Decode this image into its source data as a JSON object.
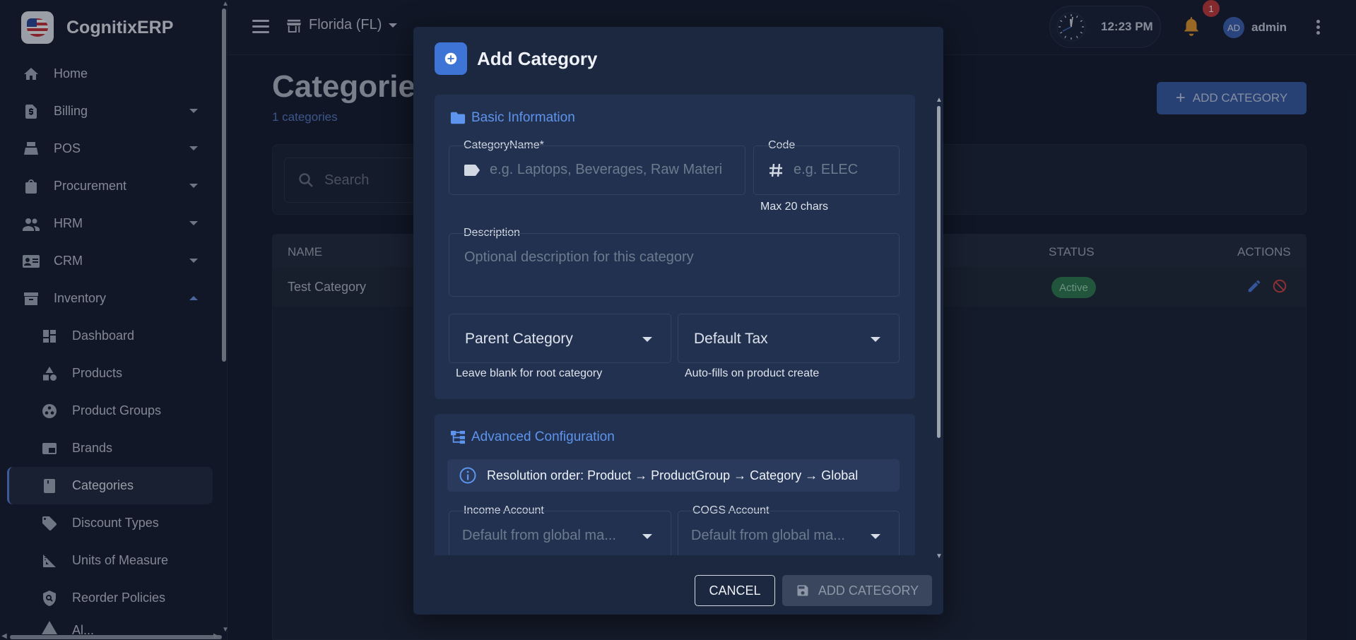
{
  "app": {
    "name": "CognitixERP"
  },
  "topbar": {
    "store": "Florida (FL)",
    "time": "12:23 PM",
    "notifications": "1",
    "avatar_initials": "AD",
    "username": "admin"
  },
  "sidebar": {
    "items": [
      {
        "label": "Home",
        "icon": "home-icon"
      },
      {
        "label": "Billing",
        "icon": "billing-icon"
      },
      {
        "label": "POS",
        "icon": "pos-icon"
      },
      {
        "label": "Procurement",
        "icon": "procurement-icon"
      },
      {
        "label": "HRM",
        "icon": "people-icon"
      },
      {
        "label": "CRM",
        "icon": "contact-card-icon"
      },
      {
        "label": "Inventory",
        "icon": "inventory-icon"
      }
    ],
    "inventory_sub": [
      {
        "label": "Dashboard",
        "icon": "dashboard-icon"
      },
      {
        "label": "Products",
        "icon": "category-shapes-icon"
      },
      {
        "label": "Product Groups",
        "icon": "workspaces-icon"
      },
      {
        "label": "Brands",
        "icon": "brand-icon"
      },
      {
        "label": "Categories",
        "icon": "book-icon"
      },
      {
        "label": "Discount Types",
        "icon": "tag-icon"
      },
      {
        "label": "Units of Measure",
        "icon": "ruler-icon"
      },
      {
        "label": "Reorder Policies",
        "icon": "policy-icon"
      },
      {
        "label": "Al...",
        "icon": "alert-icon"
      }
    ]
  },
  "main": {
    "title": "Categorie",
    "subtitle": "1 categories",
    "add_button": "ADD CATEGORY",
    "search_placeholder": "Search",
    "table": {
      "headers": {
        "name": "NAME",
        "status": "STATUS",
        "actions": "ACTIONS"
      },
      "rows": [
        {
          "name": "Test Category",
          "status": "Active"
        }
      ]
    }
  },
  "modal": {
    "title": "Add Category",
    "basic": {
      "title": "Basic Information",
      "name_label": "CategoryName*",
      "name_placeholder": "e.g. Laptops, Beverages, Raw Materi",
      "code_label": "Code",
      "code_placeholder": "e.g. ELEC",
      "code_helper": "Max 20 chars",
      "desc_label": "Description",
      "desc_placeholder": "Optional description for this category",
      "parent_label": "Parent Category",
      "parent_helper": "Leave blank for root category",
      "tax_label": "Default Tax",
      "tax_helper": "Auto-fills on product create"
    },
    "advanced": {
      "title": "Advanced Configuration",
      "info": "Resolution order: Product → ProductGroup → Category → Global",
      "income_label": "Income Account",
      "income_placeholder": "Default from global ma...",
      "cogs_label": "COGS Account",
      "cogs_placeholder": "Default from global ma..."
    },
    "cancel": "CANCEL",
    "submit": "ADD CATEGORY"
  },
  "colors": {
    "accent": "#3e74d6",
    "active_status": "#2e7d50",
    "danger": "#d24646"
  }
}
